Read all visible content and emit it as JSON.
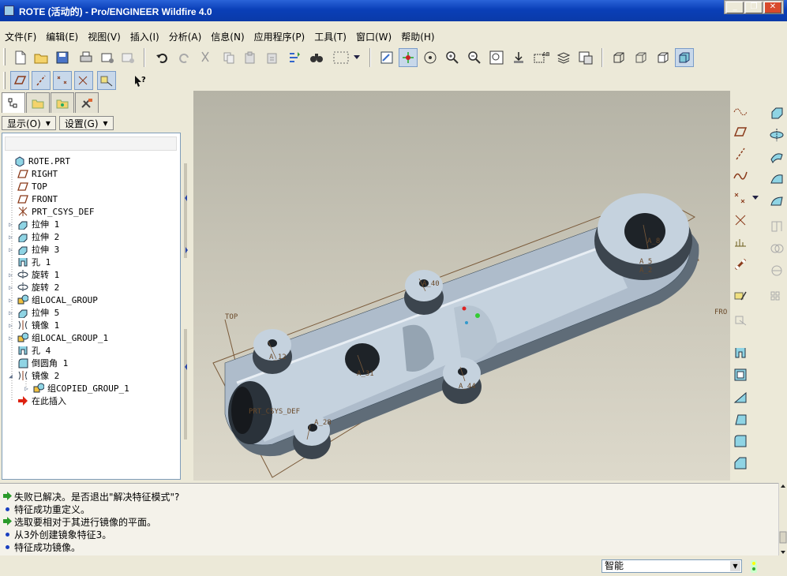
{
  "window": {
    "title": "ROTE (活动的) - Pro/ENGINEER Wildfire 4.0"
  },
  "menu": [
    "文件(F)",
    "编辑(E)",
    "视图(V)",
    "插入(I)",
    "分析(A)",
    "信息(N)",
    "应用程序(P)",
    "工具(T)",
    "窗口(W)",
    "帮助(H)"
  ],
  "panel": {
    "show_label": "显示(O)",
    "settings_label": "设置(G)"
  },
  "tree": [
    {
      "label": "ROTE.PRT",
      "icon": "part-icon",
      "level": 0,
      "expand": ""
    },
    {
      "label": "RIGHT",
      "icon": "datum-plane-icon",
      "level": 1,
      "expand": ""
    },
    {
      "label": "TOP",
      "icon": "datum-plane-icon",
      "level": 1,
      "expand": ""
    },
    {
      "label": "FRONT",
      "icon": "datum-plane-icon",
      "level": 1,
      "expand": ""
    },
    {
      "label": "PRT_CSYS_DEF",
      "icon": "csys-icon",
      "level": 1,
      "expand": ""
    },
    {
      "label": "拉伸 1",
      "icon": "extrude-icon",
      "level": 1,
      "expand": "▷"
    },
    {
      "label": "拉伸 2",
      "icon": "extrude-icon",
      "level": 1,
      "expand": "▷"
    },
    {
      "label": "拉伸 3",
      "icon": "extrude-icon",
      "level": 1,
      "expand": "▷"
    },
    {
      "label": "孔 1",
      "icon": "hole-icon",
      "level": 1,
      "expand": ""
    },
    {
      "label": "旋转 1",
      "icon": "revolve-icon",
      "level": 1,
      "expand": "▷"
    },
    {
      "label": "旋转 2",
      "icon": "revolve-icon",
      "level": 1,
      "expand": "▷"
    },
    {
      "label": "组LOCAL_GROUP",
      "icon": "group-icon",
      "level": 1,
      "expand": "▷"
    },
    {
      "label": "拉伸 5",
      "icon": "extrude-icon",
      "level": 1,
      "expand": "▷"
    },
    {
      "label": "镜像 1",
      "icon": "mirror-icon",
      "level": 1,
      "expand": "▷"
    },
    {
      "label": "组LOCAL_GROUP_1",
      "icon": "group-icon",
      "level": 1,
      "expand": "▷"
    },
    {
      "label": "孔 4",
      "icon": "hole-icon",
      "level": 1,
      "expand": ""
    },
    {
      "label": "倒圆角 1",
      "icon": "round-icon",
      "level": 1,
      "expand": ""
    },
    {
      "label": "镜像 2",
      "icon": "mirror-icon",
      "level": 1,
      "expand": "◢"
    },
    {
      "label": "组COPIED_GROUP_1",
      "icon": "group-icon",
      "level": 2,
      "expand": "▷"
    },
    {
      "label": "在此插入",
      "icon": "insert-here-icon",
      "level": 1,
      "expand": ""
    }
  ],
  "viewport": {
    "labels": {
      "top": "TOP",
      "front": "FRO",
      "csys": "PRT_CSYS_DEF",
      "a12": "A_12",
      "a31": "A_31",
      "a40": "A_40",
      "a44": "A_44",
      "a28": "A_28",
      "a8": "A_8",
      "a5": "A_5",
      "a2": "A_2"
    }
  },
  "messages": [
    {
      "kind": "arrow",
      "text": "失败已解决。是否退出\"解决特征模式\"?"
    },
    {
      "kind": "info",
      "text": "特征成功重定义。"
    },
    {
      "kind": "arrow",
      "text": "选取要相对于其进行镜像的平面。"
    },
    {
      "kind": "info",
      "text": "从3外创建镜象特征3。"
    },
    {
      "kind": "info",
      "text": "特征成功镜像。"
    }
  ],
  "status": {
    "filter_value": "智能"
  },
  "colors": {
    "titlebar": "#0a3fb8",
    "viewport_bg": "#c8c5b7",
    "model": "#b8c7d6",
    "datum": "#7a5a3a"
  }
}
